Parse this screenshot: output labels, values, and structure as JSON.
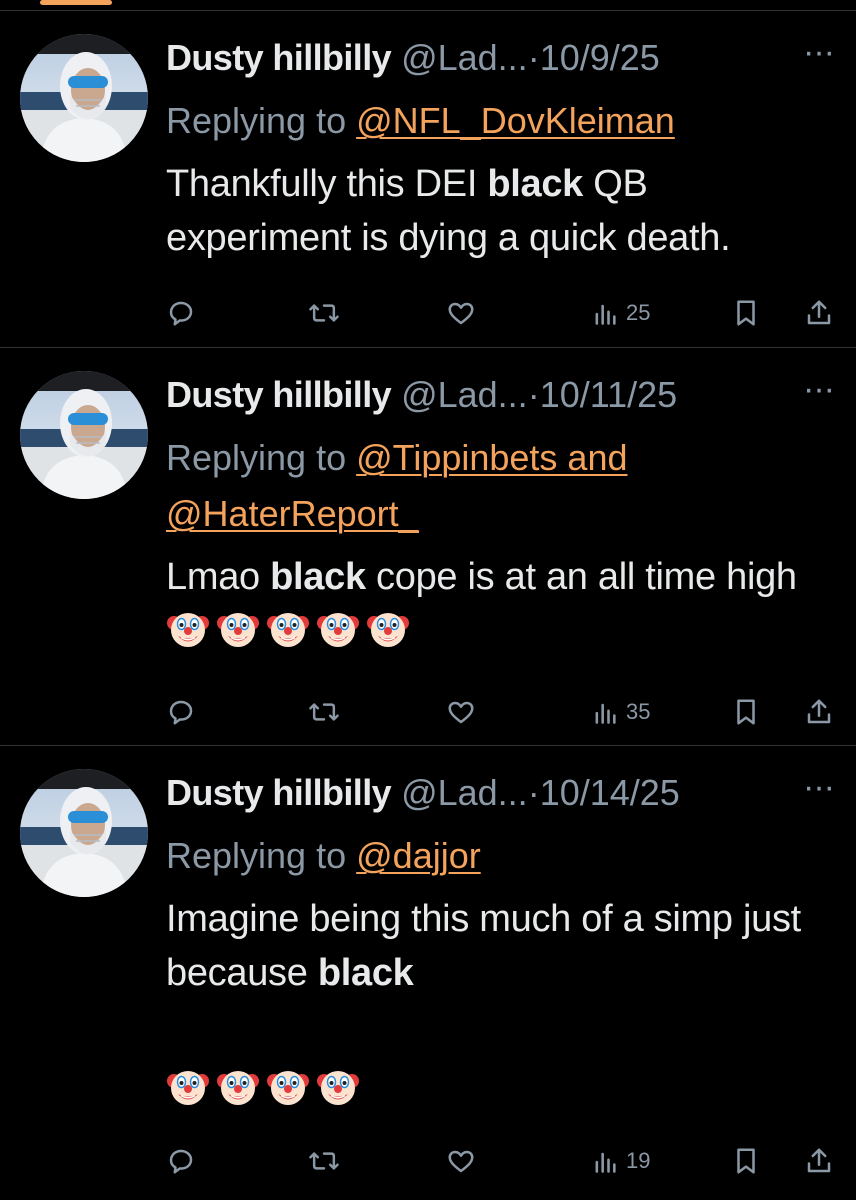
{
  "colors": {
    "background": "#000000",
    "text": "#e7e9ea",
    "muted": "#8b98a5",
    "mention": "#f4a35c",
    "divider": "#2f3336"
  },
  "tweets": [
    {
      "author_name": "Dusty hillbilly",
      "handle": "@Lad...",
      "separator": "·",
      "date": "10/9/25",
      "more_label": "···",
      "replying_prefix": "Replying to",
      "mentions_text": "@NFL_DovKleiman",
      "body_before": "Thankfully this DEI ",
      "body_bold": "black",
      "body_after": " QB experiment is dying a quick death.",
      "views": "25"
    },
    {
      "author_name": "Dusty hillbilly",
      "handle": "@Lad...",
      "separator": "·",
      "date": "10/11/25",
      "more_label": "···",
      "replying_prefix": "Replying to",
      "mentions_text": "@Tippinbets and @HaterReport_",
      "body_before": "Lmao ",
      "body_bold": "black",
      "body_after": " cope is at an all time high",
      "emoji_count": 5,
      "emoji_name": "clown-face",
      "views": "35"
    },
    {
      "author_name": "Dusty hillbilly",
      "handle": "@Lad...",
      "separator": "·",
      "date": "10/14/25",
      "more_label": "···",
      "replying_prefix": "Replying to",
      "mentions_text": "@dajjor",
      "body_before": "Imagine being this much of a simp just because ",
      "body_bold": "black",
      "body_after": "",
      "emoji_count": 4,
      "emoji_name": "clown-face",
      "views": "19"
    }
  ],
  "icons": {
    "reply": "reply-icon",
    "repost": "repost-icon",
    "like": "like-icon",
    "views": "views-icon",
    "bookmark": "bookmark-icon",
    "share": "share-icon",
    "avatar": "avatar-image",
    "emoji": "clown-face-icon"
  }
}
